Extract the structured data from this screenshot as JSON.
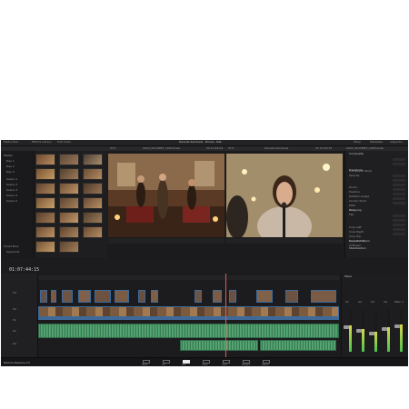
{
  "app": {
    "brand": "DaVinci Resolve 15",
    "project_title": "Danelle Sandoval - Bones - RAL",
    "accent": "#e25a5a"
  },
  "topbar": {
    "media_pool_label": "Media Pool",
    "effects_label": "Effects Library",
    "edit_index_label": "Edit Index",
    "sound_library_label": "Sound Library",
    "mixer_label": "Mixer",
    "metadata_label": "Metadata",
    "inspector_label": "Inspector"
  },
  "viewers": {
    "source_zoom": "51%",
    "source_clip": "A003_0612ME3_C005.braw",
    "source_tc": "00:13:44:02",
    "timeline_zoom": "51%",
    "timeline_name": "Danelle Sandoval",
    "timeline_tc": "01:07:44:15"
  },
  "timeline": {
    "timecode": "01:07:44:15",
    "tracks": [
      "V3",
      "V2",
      "V1",
      "A1",
      "A2"
    ]
  },
  "bins": [
    "Master",
    "Day 1",
    "Day 2",
    "Day 3",
    "Scene 1",
    "Scene 2",
    "Scene 3",
    "Scene 4",
    "Scene 5",
    "Smart Bins",
    "Keywords"
  ],
  "inspector": {
    "clip_name": "A003_0612ME3_C005.braw",
    "sections": [
      "Composite",
      "Transform",
      "Cropping",
      "Dynamic Zoom",
      "Stabilization"
    ],
    "fields": [
      "Composite Mode",
      "Opacity",
      "Zoom",
      "Position",
      "Rotation Angle",
      "Anchor Point",
      "Pitch",
      "Yaw",
      "Flip",
      "Crop Left",
      "Crop Right",
      "Crop Top",
      "Crop Bottom",
      "Softness"
    ]
  },
  "mixer": {
    "channels": [
      "A1",
      "A2",
      "A3",
      "A4",
      "Main 1"
    ],
    "levels": [
      0.62,
      0.55,
      0.48,
      0.58,
      0.66
    ]
  },
  "pagebar": {
    "pages": [
      "Media",
      "Cut",
      "Edit",
      "Fusion",
      "Color",
      "Fairlight",
      "Deliver"
    ],
    "active": "Edit"
  }
}
